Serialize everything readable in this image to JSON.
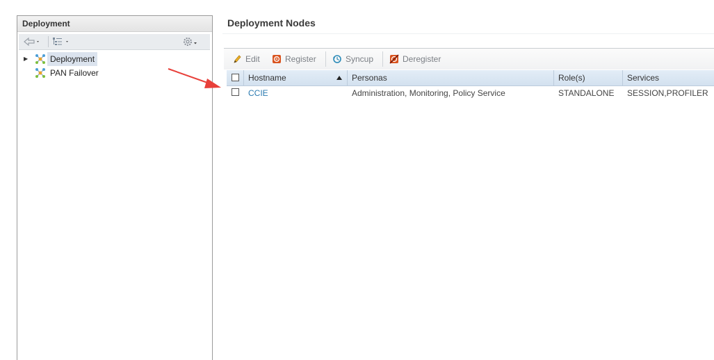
{
  "left_panel": {
    "title": "Deployment",
    "tree": [
      {
        "label": "Deployment",
        "selected": true,
        "expandable": true
      },
      {
        "label": "PAN Failover",
        "selected": false,
        "expandable": false
      }
    ]
  },
  "main": {
    "title": "Deployment Nodes",
    "toolbar": {
      "edit": "Edit",
      "register": "Register",
      "syncup": "Syncup",
      "deregister": "Deregister"
    },
    "table": {
      "headers": {
        "hostname": "Hostname",
        "personas": "Personas",
        "roles": "Role(s)",
        "services": "Services"
      },
      "rows": [
        {
          "hostname": "CCIE",
          "personas": "Administration, Monitoring, Policy Service",
          "roles": "STANDALONE",
          "services": "SESSION,PROFILER"
        }
      ]
    }
  },
  "colors": {
    "link": "#2a7ab0",
    "header_bg": "#dbe6f2",
    "arrow": "#e8403a"
  },
  "icons": [
    "back-arrow-icon",
    "tree-view-icon",
    "gear-icon",
    "node-icon",
    "edit-pencil-icon",
    "register-icon",
    "syncup-icon",
    "deregister-icon",
    "sort-ascending-icon"
  ]
}
